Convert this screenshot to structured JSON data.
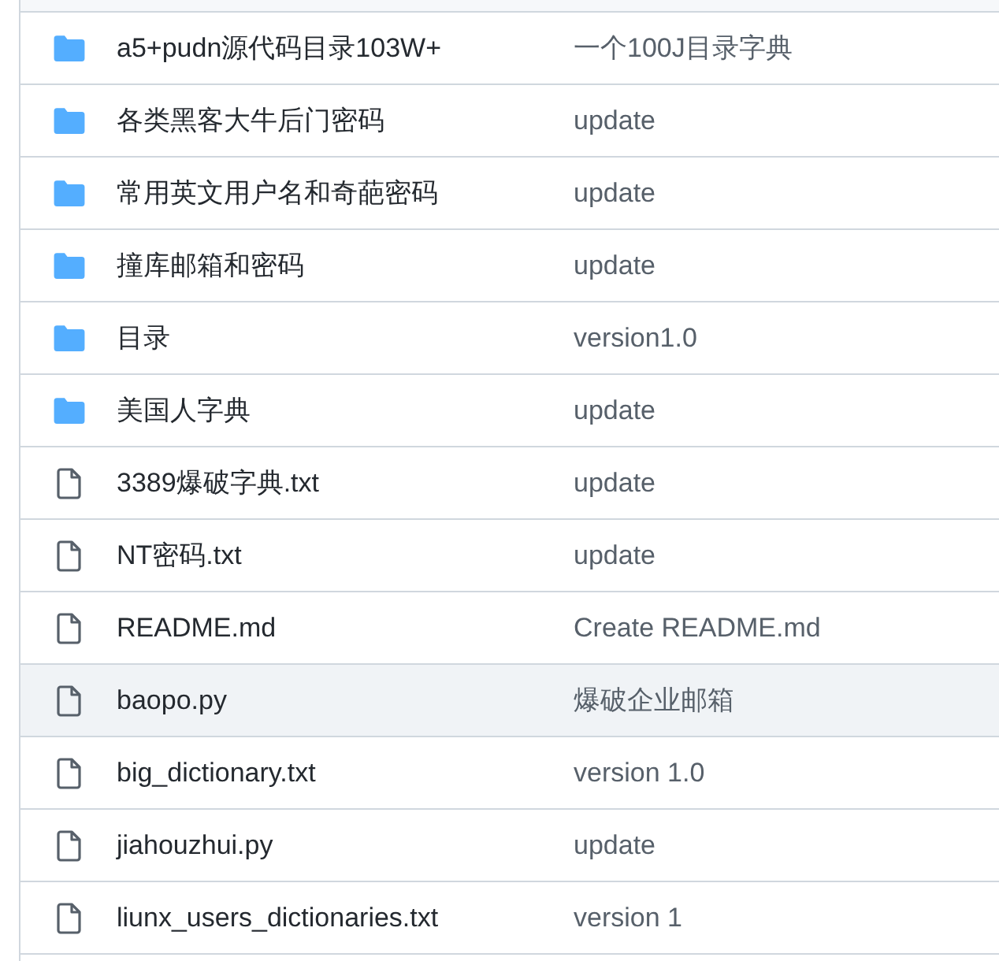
{
  "files": [
    {
      "kind": "folder",
      "name": "a5+pudn源代码目录103W+",
      "message": "一个100J目录字典",
      "highlighted": false
    },
    {
      "kind": "folder",
      "name": "各类黑客大牛后门密码",
      "message": "update",
      "highlighted": false
    },
    {
      "kind": "folder",
      "name": "常用英文用户名和奇葩密码",
      "message": "update",
      "highlighted": false
    },
    {
      "kind": "folder",
      "name": "撞库邮箱和密码",
      "message": "update",
      "highlighted": false
    },
    {
      "kind": "folder",
      "name": "目录",
      "message": "version1.0",
      "highlighted": false
    },
    {
      "kind": "folder",
      "name": "美国人字典",
      "message": "update",
      "highlighted": false
    },
    {
      "kind": "file",
      "name": "3389爆破字典.txt",
      "message": "update",
      "highlighted": false
    },
    {
      "kind": "file",
      "name": "NT密码.txt",
      "message": "update",
      "highlighted": false
    },
    {
      "kind": "file",
      "name": "README.md",
      "message": "Create README.md",
      "highlighted": false
    },
    {
      "kind": "file",
      "name": "baopo.py",
      "message": "爆破企业邮箱",
      "highlighted": true
    },
    {
      "kind": "file",
      "name": "big_dictionary.txt",
      "message": "version 1.0",
      "highlighted": false
    },
    {
      "kind": "file",
      "name": "jiahouzhui.py",
      "message": "update",
      "highlighted": false
    },
    {
      "kind": "file",
      "name": "liunx_users_dictionaries.txt",
      "message": "version 1",
      "highlighted": false
    }
  ]
}
